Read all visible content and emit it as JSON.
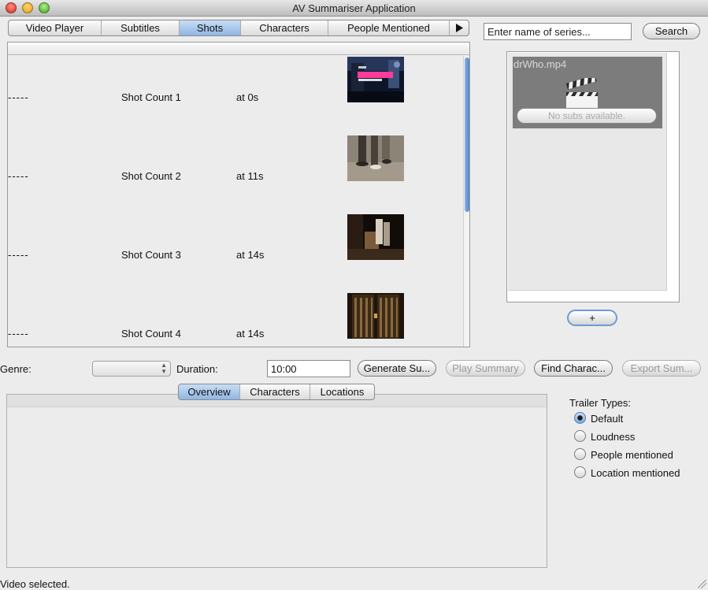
{
  "window": {
    "title": "AV Summariser Application"
  },
  "tabs": [
    {
      "label": "Video Player",
      "selected": false
    },
    {
      "label": "Subtitles",
      "selected": false
    },
    {
      "label": "Shots",
      "selected": true
    },
    {
      "label": "Characters",
      "selected": false
    },
    {
      "label": "People Mentioned",
      "selected": false
    }
  ],
  "tabs_more_icon": "right-triangle-icon",
  "shots": [
    {
      "dash": "-----",
      "label": "Shot Count 1",
      "time": "at 0s"
    },
    {
      "dash": "-----",
      "label": "Shot Count 2",
      "time": "at 11s"
    },
    {
      "dash": "-----",
      "label": "Shot Count 3",
      "time": "at 14s"
    },
    {
      "dash": "-----",
      "label": "Shot Count 4",
      "time": "at 14s"
    }
  ],
  "search": {
    "value": "Enter name of series...",
    "button_label": "Search"
  },
  "series": [
    {
      "filename": "drWho.mp4",
      "status": "No subs available."
    }
  ],
  "add_button_label": "+",
  "controls": {
    "genre_label": "Genre:",
    "genre_value": "",
    "duration_label": "Duration:",
    "duration_value": "10:00",
    "generate_label": "Generate Su...",
    "play_label": "Play Summary",
    "find_label": "Find Charac...",
    "export_label": "Export Sum..."
  },
  "bottom_tabs": [
    {
      "label": "Overview",
      "selected": true
    },
    {
      "label": "Characters",
      "selected": false
    },
    {
      "label": "Locations",
      "selected": false
    }
  ],
  "trailer": {
    "title": "Trailer Types:",
    "options": [
      {
        "label": "Default",
        "checked": true
      },
      {
        "label": "Loudness",
        "checked": false
      },
      {
        "label": "People mentioned",
        "checked": false
      },
      {
        "label": "Location mentioned",
        "checked": false
      }
    ]
  },
  "status": "Video selected.",
  "colors": {
    "accent": "#8fb6e3",
    "window_bg": "#ececec",
    "series_tile": "#7c7c7c"
  }
}
